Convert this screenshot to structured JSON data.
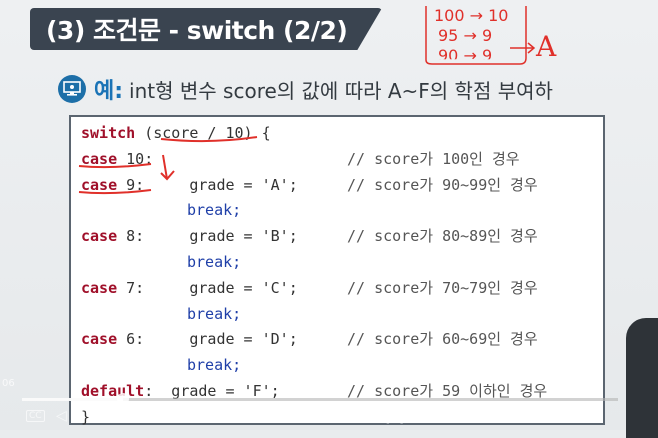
{
  "title": "(3) 조건문 - switch (2/2)",
  "annotations": {
    "line1": "100 → 10",
    "line2": "95 → 9",
    "line3": "90 → 9",
    "result": "A"
  },
  "example": {
    "label": "예:",
    "text": "int형 변수 score의 값에 따라 A~F의 학점 부여하"
  },
  "code": {
    "l1_kw": "switch",
    "l1_rest": " (score / 10) {",
    "l2_kw": "case",
    "l2_rest": " 10:",
    "l2_comment": "// score가 100인 경우",
    "l3_kw": "case",
    "l3_rest": " 9:     grade = 'A';",
    "l3_comment": "// score가 90~99인 경우",
    "l4_break": "break;",
    "l5_kw": "case",
    "l5_rest": " 8:     grade = 'B';",
    "l5_comment": "// score가 80~89인 경우",
    "l6_break": "break;",
    "l7_kw": "case",
    "l7_rest": " 7:     grade = 'C';",
    "l7_comment": "// score가 70~79인 경우",
    "l8_break": "break;",
    "l9_kw": "case",
    "l9_rest": " 6:     grade = 'D';",
    "l9_comment": "// score가 60~69인 경우",
    "l10_break": "break;",
    "l11_kw": "default",
    "l11_rest": ":  grade = 'F';",
    "l11_comment": "// score가 59 이하인 경우",
    "l12": "}"
  },
  "player": {
    "time": "06",
    "progress_fraction": 0.17,
    "icons": [
      "subtitles-icon",
      "volume-icon",
      "rewind-icon",
      "pause-icon",
      "forward-icon"
    ]
  }
}
